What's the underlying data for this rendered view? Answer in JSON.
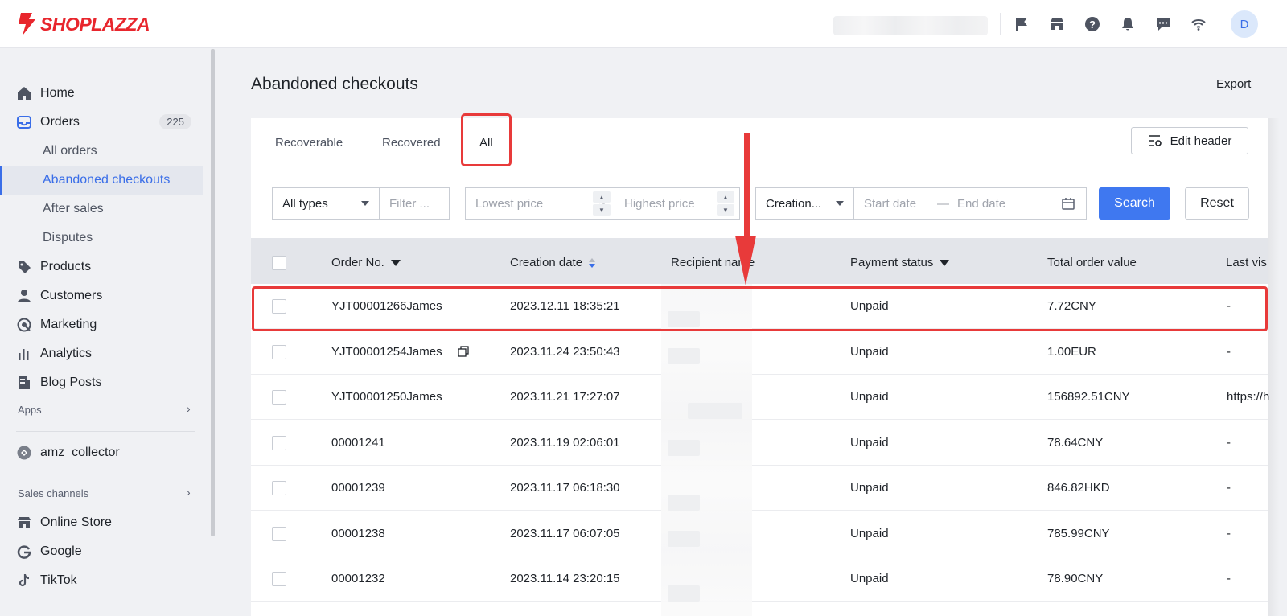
{
  "brand": {
    "name": "SHOPLAZZA",
    "color": "#e8262d"
  },
  "topbar": {
    "icons": [
      "flag-icon",
      "store-icon",
      "help-icon",
      "bell-icon",
      "chat-icon",
      "wifi-icon"
    ],
    "avatar_initial": "D"
  },
  "sidebar": {
    "items": [
      {
        "label": "Home",
        "icon": "home-icon"
      },
      {
        "label": "Orders",
        "icon": "inbox-icon",
        "badge": "225"
      },
      {
        "label": "All orders"
      },
      {
        "label": "Abandoned checkouts",
        "active": true
      },
      {
        "label": "After sales"
      },
      {
        "label": "Disputes"
      },
      {
        "label": "Products",
        "icon": "tag-icon"
      },
      {
        "label": "Customers",
        "icon": "person-icon"
      },
      {
        "label": "Marketing",
        "icon": "target-icon"
      },
      {
        "label": "Analytics",
        "icon": "bar-chart-icon"
      },
      {
        "label": "Blog Posts",
        "icon": "document-icon"
      }
    ],
    "apps_label": "Apps",
    "app_item": "amz_collector",
    "sales_channels_label": "Sales channels",
    "channels": [
      {
        "label": "Online Store",
        "icon": "store-icon"
      },
      {
        "label": "Google",
        "icon": "google-icon"
      },
      {
        "label": "TikTok",
        "icon": "tiktok-icon"
      }
    ]
  },
  "main": {
    "title": "Abandoned checkouts",
    "export_label": "Export",
    "tabs": [
      {
        "label": "Recoverable"
      },
      {
        "label": "Recovered"
      },
      {
        "label": "All",
        "active": true
      }
    ],
    "edit_header_label": "Edit header",
    "filters": {
      "type_value": "All types",
      "filter_placeholder": "Filter ...",
      "lowest_price_placeholder": "Lowest price",
      "range_separator": "~",
      "highest_price_placeholder": "Highest price",
      "date_type_value": "Creation...",
      "start_date_placeholder": "Start date",
      "date_separator": "—",
      "end_date_placeholder": "End date",
      "search_label": "Search",
      "reset_label": "Reset"
    },
    "table": {
      "columns": [
        "Order No.",
        "Creation date",
        "Recipient name",
        "Payment status",
        "Total order value",
        "Last vis"
      ],
      "rows": [
        {
          "order_no": "YJT00001266James",
          "date": "2023.12.11 18:35:21",
          "status": "Unpaid",
          "total": "7.72CNY",
          "last": "-"
        },
        {
          "order_no": "YJT00001254James",
          "date": "2023.11.24 23:50:43",
          "status": "Unpaid",
          "total": "1.00EUR",
          "last": "-"
        },
        {
          "order_no": "YJT00001250James",
          "date": "2023.11.21 17:27:07",
          "status": "Unpaid",
          "total": "156892.51CNY",
          "last": "https://h"
        },
        {
          "order_no": "00001241",
          "date": "2023.11.19 02:06:01",
          "status": "Unpaid",
          "total": "78.64CNY",
          "last": "-"
        },
        {
          "order_no": "00001239",
          "date": "2023.11.17 06:18:30",
          "status": "Unpaid",
          "total": "846.82HKD",
          "last": "-"
        },
        {
          "order_no": "00001238",
          "date": "2023.11.17 06:07:05",
          "status": "Unpaid",
          "total": "785.99CNY",
          "last": "-"
        },
        {
          "order_no": "00001232",
          "date": "2023.11.14 23:20:15",
          "status": "Unpaid",
          "total": "78.90CNY",
          "last": "-"
        }
      ]
    }
  },
  "colors": {
    "accent": "#3f78f0",
    "highlight": "#e83a3a",
    "active_nav": "#3a6ee8"
  }
}
